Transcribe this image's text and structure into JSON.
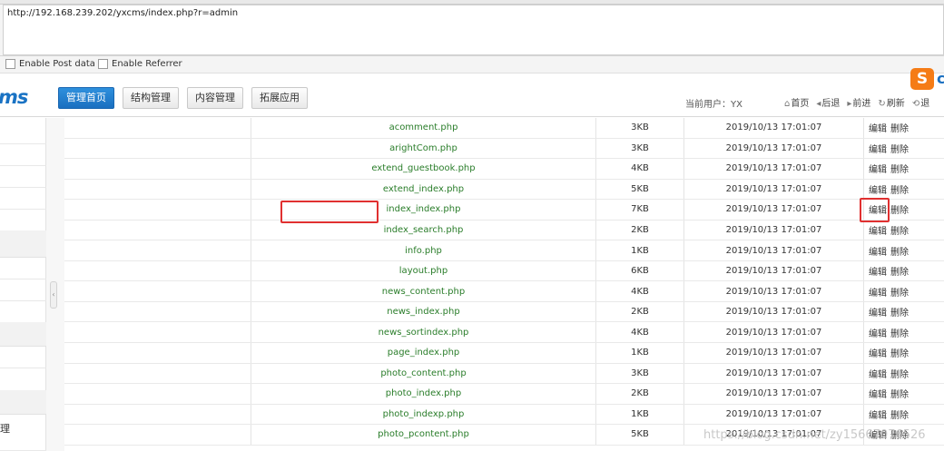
{
  "browser": {
    "url": "http://192.168.239.202/yxcms/index.php?r=admin",
    "options": [
      "Enable Post data",
      "Enable Referrer"
    ]
  },
  "header": {
    "logo": "ms",
    "nav": [
      "管理首页",
      "结构管理",
      "内容管理",
      "拓展应用"
    ],
    "user": "当前用户：YX",
    "links": [
      {
        "icon": "home-icon",
        "label": "首页"
      },
      {
        "icon": "back-icon",
        "label": "后退"
      },
      {
        "icon": "forward-icon",
        "label": "前进"
      },
      {
        "icon": "refresh-icon",
        "label": "刷新"
      },
      {
        "icon": "exit-icon",
        "label": "退"
      }
    ],
    "sogou": "S",
    "sogou2": "c"
  },
  "sidebar": {
    "partial_label": "理"
  },
  "table": {
    "rows": [
      {
        "name": "acomment.php",
        "size": "3KB",
        "date": "2019/10/13 17:01:07"
      },
      {
        "name": "arightCom.php",
        "size": "3KB",
        "date": "2019/10/13 17:01:07"
      },
      {
        "name": "extend_guestbook.php",
        "size": "4KB",
        "date": "2019/10/13 17:01:07"
      },
      {
        "name": "extend_index.php",
        "size": "5KB",
        "date": "2019/10/13 17:01:07"
      },
      {
        "name": "index_index.php",
        "size": "7KB",
        "date": "2019/10/13 17:01:07"
      },
      {
        "name": "index_search.php",
        "size": "2KB",
        "date": "2019/10/13 17:01:07"
      },
      {
        "name": "info.php",
        "size": "1KB",
        "date": "2019/10/13 17:01:07"
      },
      {
        "name": "layout.php",
        "size": "6KB",
        "date": "2019/10/13 17:01:07"
      },
      {
        "name": "news_content.php",
        "size": "4KB",
        "date": "2019/10/13 17:01:07"
      },
      {
        "name": "news_index.php",
        "size": "2KB",
        "date": "2019/10/13 17:01:07"
      },
      {
        "name": "news_sortindex.php",
        "size": "4KB",
        "date": "2019/10/13 17:01:07"
      },
      {
        "name": "page_index.php",
        "size": "1KB",
        "date": "2019/10/13 17:01:07"
      },
      {
        "name": "photo_content.php",
        "size": "3KB",
        "date": "2019/10/13 17:01:07"
      },
      {
        "name": "photo_index.php",
        "size": "2KB",
        "date": "2019/10/13 17:01:07"
      },
      {
        "name": "photo_indexp.php",
        "size": "1KB",
        "date": "2019/10/13 17:01:07"
      },
      {
        "name": "photo_pcontent.php",
        "size": "5KB",
        "date": "2019/10/13 17:01:07"
      }
    ],
    "edit_label": "编辑",
    "delete_label": "删除"
  },
  "watermark": "https://blog.csdn.net/zy15667076526"
}
